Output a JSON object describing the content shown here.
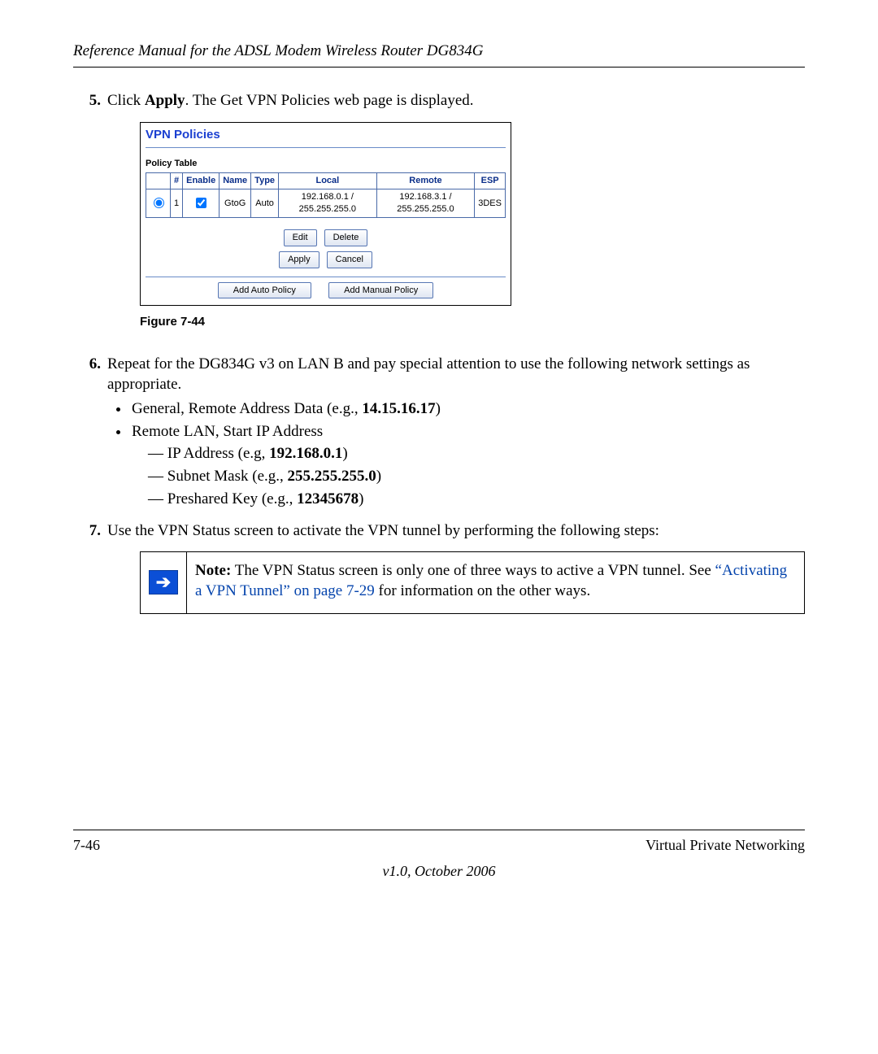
{
  "header": {
    "title": "Reference Manual for the ADSL Modem Wireless Router DG834G"
  },
  "steps": {
    "s5": {
      "num": "5.",
      "pre": "Click ",
      "bold": "Apply",
      "post": ". The Get VPN Policies web page is displayed."
    },
    "s6": {
      "num": "6.",
      "text": "Repeat for the DG834G v3 on LAN B and pay special attention to use the following network settings as appropriate.",
      "b1": {
        "pre": "General, Remote Address Data (e.g., ",
        "bold": "14.15.16.17",
        "post": ")"
      },
      "b2": "Remote LAN, Start IP Address",
      "d1": {
        "pre": "IP Address (e.g, ",
        "bold": "192.168.0.1",
        "post": ")"
      },
      "d2": {
        "pre": "Subnet Mask (e.g., ",
        "bold": "255.255.255.0",
        "post": ")"
      },
      "d3": {
        "pre": "Preshared Key (e.g., ",
        "bold": "12345678",
        "post": ")"
      }
    },
    "s7": {
      "num": "7.",
      "text": "Use the VPN Status screen to activate the VPN tunnel by performing the following steps:"
    }
  },
  "figure_caption": "Figure 7-44",
  "vpn": {
    "title": "VPN Policies",
    "table_title": "Policy Table",
    "headers": {
      "sel": "",
      "num": "#",
      "enable": "Enable",
      "name": "Name",
      "type": "Type",
      "local": "Local",
      "remote": "Remote",
      "esp": "ESP"
    },
    "row": {
      "num": "1",
      "name": "GtoG",
      "type": "Auto",
      "local": "192.168.0.1 / 255.255.255.0",
      "remote": "192.168.3.1 / 255.255.255.0",
      "esp": "3DES"
    },
    "buttons": {
      "edit": "Edit",
      "delete": "Delete",
      "apply": "Apply",
      "cancel": "Cancel",
      "add_auto": "Add Auto Policy",
      "add_manual": "Add Manual Policy"
    }
  },
  "note": {
    "bold": "Note:",
    "t1": " The VPN Status screen is only one of three ways to active a VPN tunnel. See ",
    "link": "“Activating a VPN Tunnel” on page 7-29",
    "t2": " for information on the other ways."
  },
  "footer": {
    "left": "7-46",
    "right": "Virtual Private Networking",
    "center": "v1.0, October 2006"
  }
}
